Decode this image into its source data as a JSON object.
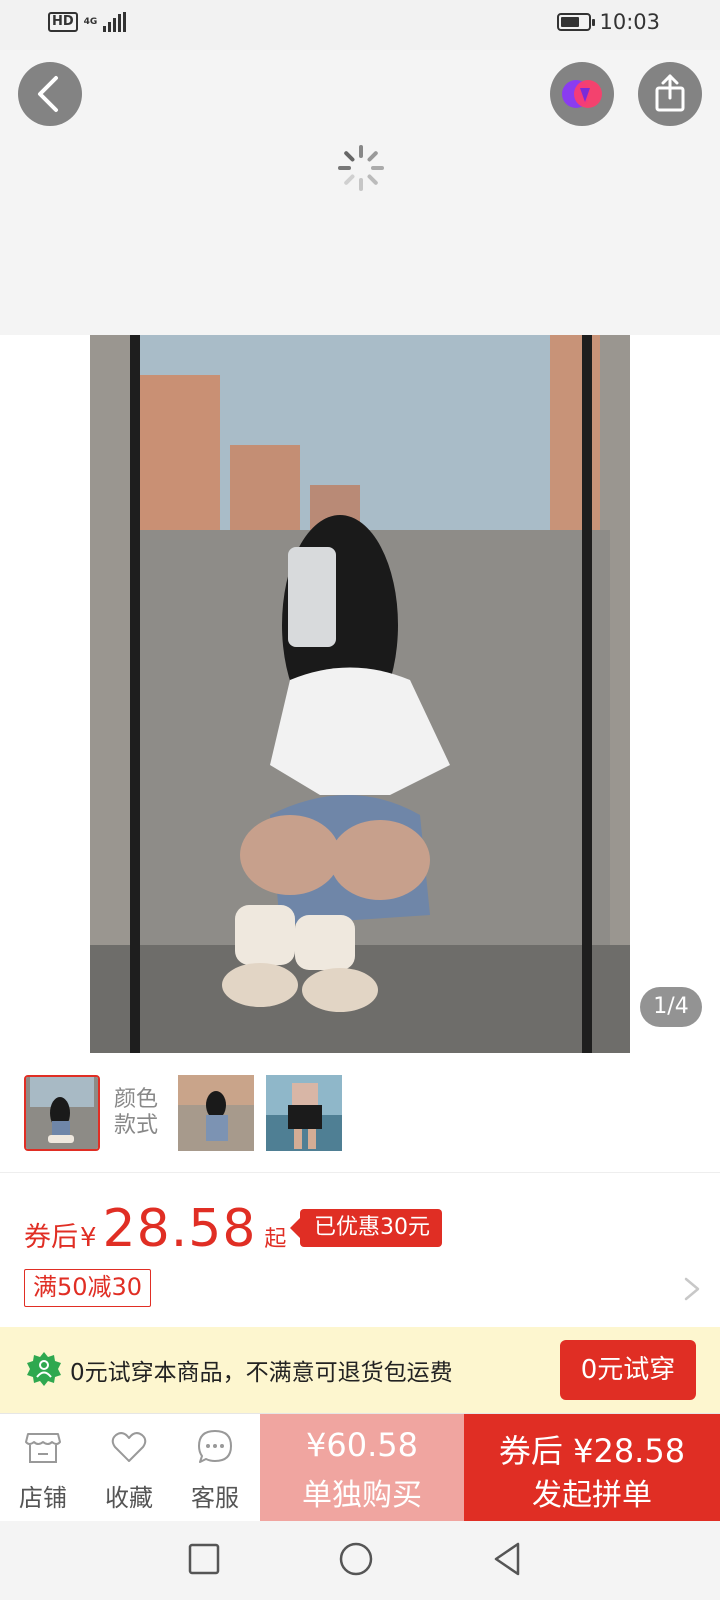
{
  "status_bar": {
    "hd_label": "HD",
    "network_label": "4G",
    "battery_level": 0.7,
    "time": "10:03"
  },
  "image_viewer": {
    "page_counter": "1/4"
  },
  "variants": {
    "label_line1": "颜色",
    "label_line2": "款式"
  },
  "price": {
    "coupon_after_label": "券后",
    "currency": "¥",
    "amount": "28.58",
    "suffix": "起",
    "discount_badge": "已优惠30元",
    "promo_tag": "满50减30"
  },
  "trial": {
    "text": "0元试穿本商品，不满意可退货包运费",
    "button": "0元试穿"
  },
  "bottom_bar": {
    "store_label": "店铺",
    "favorite_label": "收藏",
    "service_label": "客服",
    "buy_alone_price": "¥60.58",
    "buy_alone_label": "单独购买",
    "group_price": "券后 ¥28.58",
    "group_label": "发起拼单"
  },
  "colors": {
    "accent_red": "#e02e24",
    "light_red": "#f0a5a0",
    "banner_yellow": "#fdf6cf"
  }
}
